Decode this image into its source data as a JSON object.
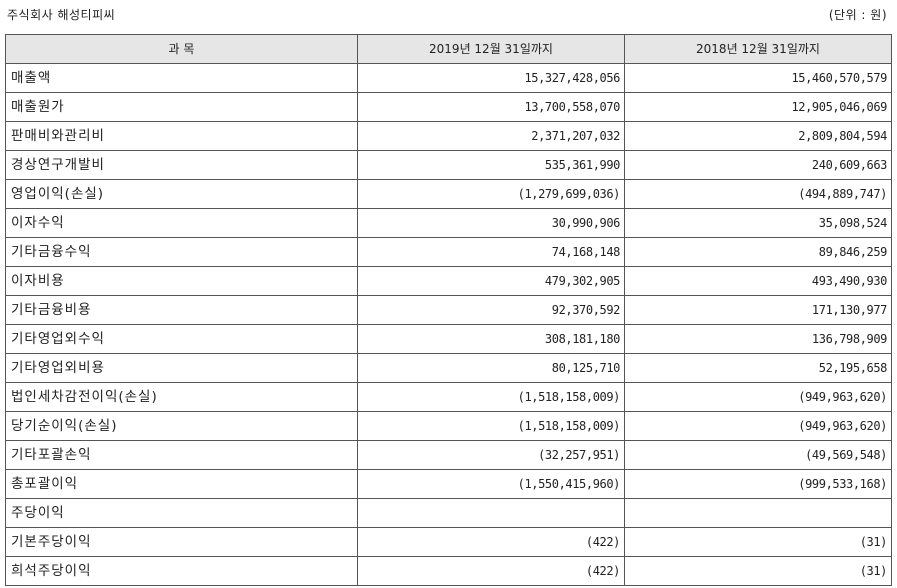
{
  "header": {
    "company": "주식회사 해성티피씨",
    "unit": "(단위 : 원)"
  },
  "table": {
    "columns": [
      "과 목",
      "2019년 12월 31일까지",
      "2018년 12월 31일까지"
    ],
    "rows": [
      {
        "item": "매출액",
        "y2019": "15,327,428,056",
        "y2018": "15,460,570,579"
      },
      {
        "item": "매출원가",
        "y2019": "13,700,558,070",
        "y2018": "12,905,046,069"
      },
      {
        "item": "판매비와관리비",
        "y2019": "2,371,207,032",
        "y2018": "2,809,804,594"
      },
      {
        "item": "경상연구개발비",
        "y2019": "535,361,990",
        "y2018": "240,609,663"
      },
      {
        "item": "영업이익(손실)",
        "y2019": "(1,279,699,036)",
        "y2018": "(494,889,747)"
      },
      {
        "item": "이자수익",
        "y2019": "30,990,906",
        "y2018": "35,098,524"
      },
      {
        "item": "기타금융수익",
        "y2019": "74,168,148",
        "y2018": "89,846,259"
      },
      {
        "item": "이자비용",
        "y2019": "479,302,905",
        "y2018": "493,490,930"
      },
      {
        "item": "기타금융비용",
        "y2019": "92,370,592",
        "y2018": "171,130,977"
      },
      {
        "item": "기타영업외수익",
        "y2019": "308,181,180",
        "y2018": "136,798,909"
      },
      {
        "item": "기타영업외비용",
        "y2019": "80,125,710",
        "y2018": "52,195,658"
      },
      {
        "item": "법인세차감전이익(손실)",
        "y2019": "(1,518,158,009)",
        "y2018": "(949,963,620)"
      },
      {
        "item": "당기순이익(손실)",
        "y2019": "(1,518,158,009)",
        "y2018": "(949,963,620)"
      },
      {
        "item": "기타포괄손익",
        "y2019": "(32,257,951)",
        "y2018": "(49,569,548)"
      },
      {
        "item": "총포괄이익",
        "y2019": "(1,550,415,960)",
        "y2018": "(999,533,168)"
      },
      {
        "item": "주당이익",
        "y2019": "",
        "y2018": ""
      },
      {
        "item": "기본주당이익",
        "y2019": "(422)",
        "y2018": "(31)"
      },
      {
        "item": "희석주당이익",
        "y2019": "(422)",
        "y2018": "(31)"
      }
    ]
  }
}
